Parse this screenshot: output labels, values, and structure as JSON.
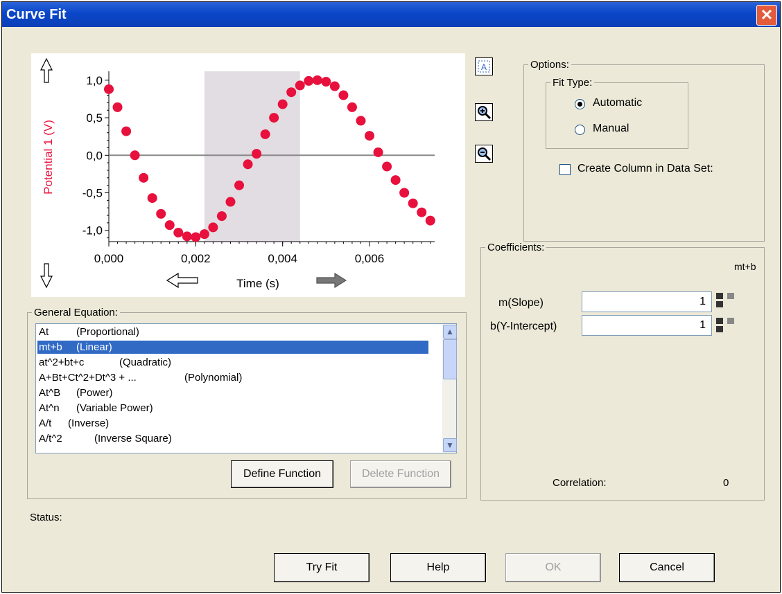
{
  "window": {
    "title": "Curve Fit",
    "close_glyph": "✕"
  },
  "graph": {
    "ylabel": "Potential 1 (V)",
    "xlabel": "Time (s)",
    "yticks": [
      "1,0",
      "0,5",
      "0,0",
      "-0,5",
      "-1,0"
    ],
    "xticks": [
      "0,000",
      "0,002",
      "0,004",
      "0,006"
    ],
    "scroll_up_icon": "up-arrow-icon",
    "scroll_down_icon": "down-arrow-icon",
    "scroll_left_icon": "left-arrow-icon",
    "scroll_right_icon": "right-arrow-icon",
    "selection_color": "#e2dde2",
    "point_color": "#e8103c",
    "label_color": "#e8103c"
  },
  "chart_data": {
    "type": "scatter",
    "xlabel": "Time (s)",
    "ylabel": "Potential 1 (V)",
    "xlim": [
      0,
      0.0075
    ],
    "ylim": [
      -1.15,
      1.1
    ],
    "selection": [
      0.0022,
      0.0044
    ],
    "series": [
      {
        "x": [
          0.0,
          0.0002,
          0.0004,
          0.0006,
          0.0008,
          0.001,
          0.0012,
          0.0014,
          0.0016,
          0.0018,
          0.002,
          0.0022,
          0.0024,
          0.0026,
          0.0028,
          0.003,
          0.0032,
          0.0034,
          0.0036,
          0.0038,
          0.004,
          0.0042,
          0.0044,
          0.0046,
          0.0048,
          0.005,
          0.0052,
          0.0054,
          0.0056,
          0.0058,
          0.006,
          0.0062,
          0.0064,
          0.0066,
          0.0068,
          0.007,
          0.0072,
          0.0074
        ],
        "values": [
          0.88,
          0.64,
          0.32,
          0.0,
          -0.3,
          -0.57,
          -0.78,
          -0.93,
          -1.03,
          -1.08,
          -1.09,
          -1.05,
          -0.96,
          -0.81,
          -0.62,
          -0.4,
          -0.12,
          0.02,
          0.28,
          0.5,
          0.68,
          0.84,
          0.93,
          0.99,
          1.0,
          0.98,
          0.92,
          0.8,
          0.64,
          0.46,
          0.26,
          0.04,
          -0.15,
          -0.33,
          -0.5,
          -0.64,
          -0.76,
          -0.87
        ]
      }
    ]
  },
  "toolbar": {
    "autoscale_icon": "autoscale-icon",
    "zoom_in_icon": "zoom-in-icon",
    "zoom_out_icon": "zoom-out-icon"
  },
  "options": {
    "legend": "Options:",
    "fit_type_legend": "Fit Type:",
    "automatic_label": "Automatic",
    "manual_label": "Manual",
    "selected": "Automatic",
    "create_column_label": "Create Column in Data Set:",
    "create_column_checked": false
  },
  "equations": {
    "legend": "General Equation:",
    "items": [
      {
        "name": "At",
        "desc": "(Proportional)"
      },
      {
        "name": "mt+b",
        "desc": "(Linear)"
      },
      {
        "name": "at^2+bt+c",
        "desc": "(Quadratic)"
      },
      {
        "name": "A+Bt+Ct^2+Dt^3 + ...",
        "desc": "(Polynomial)"
      },
      {
        "name": "At^B",
        "desc": "(Power)"
      },
      {
        "name": "At^n",
        "desc": "(Variable Power)"
      },
      {
        "name": "A/t",
        "desc": "(Inverse)"
      },
      {
        "name": "A/t^2",
        "desc": "(Inverse Square)"
      }
    ],
    "selected_index": 1,
    "define_function_label": "Define Function",
    "delete_function_label": "Delete Function"
  },
  "coefficients": {
    "legend": "Coefficients:",
    "equation": "mt+b",
    "m_label": "m(Slope)",
    "m_value": "1",
    "b_label": "b(Y-Intercept)",
    "b_value": "1",
    "correlation_label": "Correlation:",
    "correlation_value": "0"
  },
  "status": {
    "label": "Status:"
  },
  "buttons": {
    "try_fit": "Try Fit",
    "help": "Help",
    "ok": "OK",
    "cancel": "Cancel"
  }
}
